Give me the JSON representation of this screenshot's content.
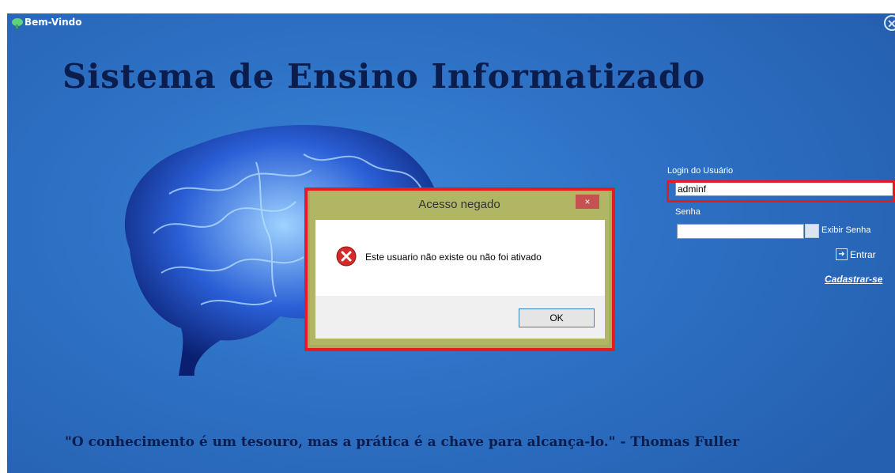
{
  "window": {
    "title": "Bem-Vindo",
    "close_glyph": "✕",
    "headline": "Sistema de Ensino Informatizado",
    "quote": "\"O conhecimento é um tesouro, mas a prática é a chave para alcança-lo.\" - Thomas Fuller"
  },
  "login": {
    "user_label": "Login do Usuário",
    "user_value": "adminf",
    "password_label": "Senha",
    "password_value": "",
    "show_password_label": "Exibir Senha",
    "enter_label": "Entrar",
    "register_label": "Cadastrar-se"
  },
  "dialog": {
    "title": "Acesso negado",
    "close_glyph": "×",
    "message": "Este usuario não existe ou não foi ativado",
    "ok_label": "OK"
  },
  "colors": {
    "background": "#2e72c6",
    "headline": "#0b1d4c",
    "highlight": "#e51b23",
    "dialog_frame": "#b0b663",
    "dialog_close": "#c75050"
  },
  "icons": {
    "app": "app-logo-icon",
    "close": "close-icon",
    "error": "error-icon",
    "enter": "enter-icon",
    "brain": "brain-image"
  }
}
